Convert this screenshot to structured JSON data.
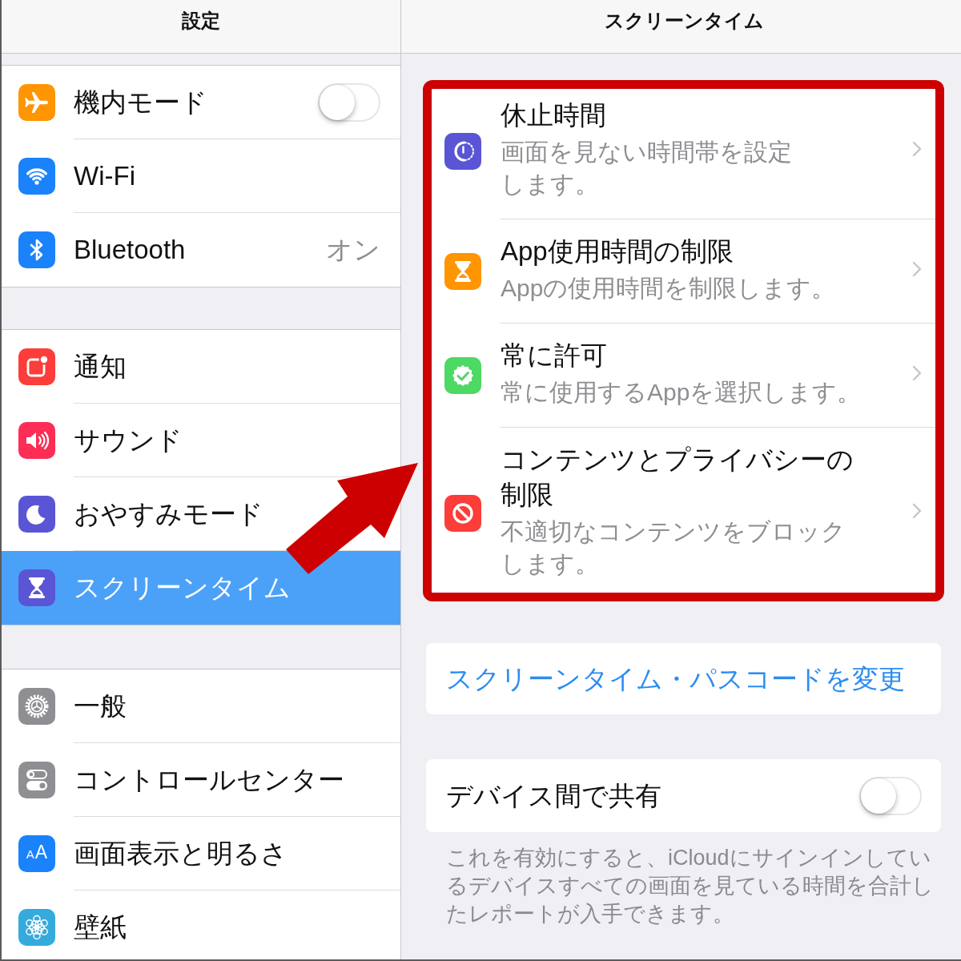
{
  "left_pane": {
    "title": "設定",
    "groups": [
      {
        "items": [
          {
            "label": "機内モード",
            "kind": "switch",
            "on": false,
            "selected": false
          },
          {
            "label": "Wi-Fi",
            "kind": "link",
            "selected": false
          },
          {
            "label": "Bluetooth",
            "kind": "detail",
            "value": "オン",
            "selected": false
          }
        ]
      },
      {
        "items": [
          {
            "label": "通知",
            "kind": "link",
            "selected": false
          },
          {
            "label": "サウンド",
            "kind": "link",
            "selected": false
          },
          {
            "label": "おやすみモード",
            "kind": "link",
            "selected": false
          },
          {
            "label": "スクリーンタイム",
            "kind": "link",
            "selected": true
          }
        ]
      },
      {
        "items": [
          {
            "label": "一般",
            "kind": "link",
            "selected": false
          },
          {
            "label": "コントロールセンター",
            "kind": "link",
            "selected": false
          },
          {
            "label": "画面表示と明るさ",
            "kind": "link",
            "icon_text": "AA",
            "selected": false
          },
          {
            "label": "壁紙",
            "kind": "link",
            "selected": false
          }
        ]
      }
    ]
  },
  "right_pane": {
    "title": "スクリーンタイム",
    "features": [
      {
        "title": "休止時間",
        "description": "画面を見ない時間帯を設定します。"
      },
      {
        "title": "App使用時間の制限",
        "description": "Appの使用時間を制限します。"
      },
      {
        "title": "常に許可",
        "description": "常に使用するAppを選択します。"
      },
      {
        "title": "コンテンツとプライバシーの制限",
        "description": "不適切なコンテンツをブロックします。"
      }
    ],
    "passcode_button": "スクリーンタイム・パスコードを変更",
    "share": {
      "label": "デバイス間で共有",
      "on": false
    },
    "footer": "これを有効にすると、iCloudにサインインしているデバイスすべての画面を見ている時間を合計したレポートが入手できます。"
  },
  "annotations": {
    "frame": true,
    "arrow": true
  }
}
